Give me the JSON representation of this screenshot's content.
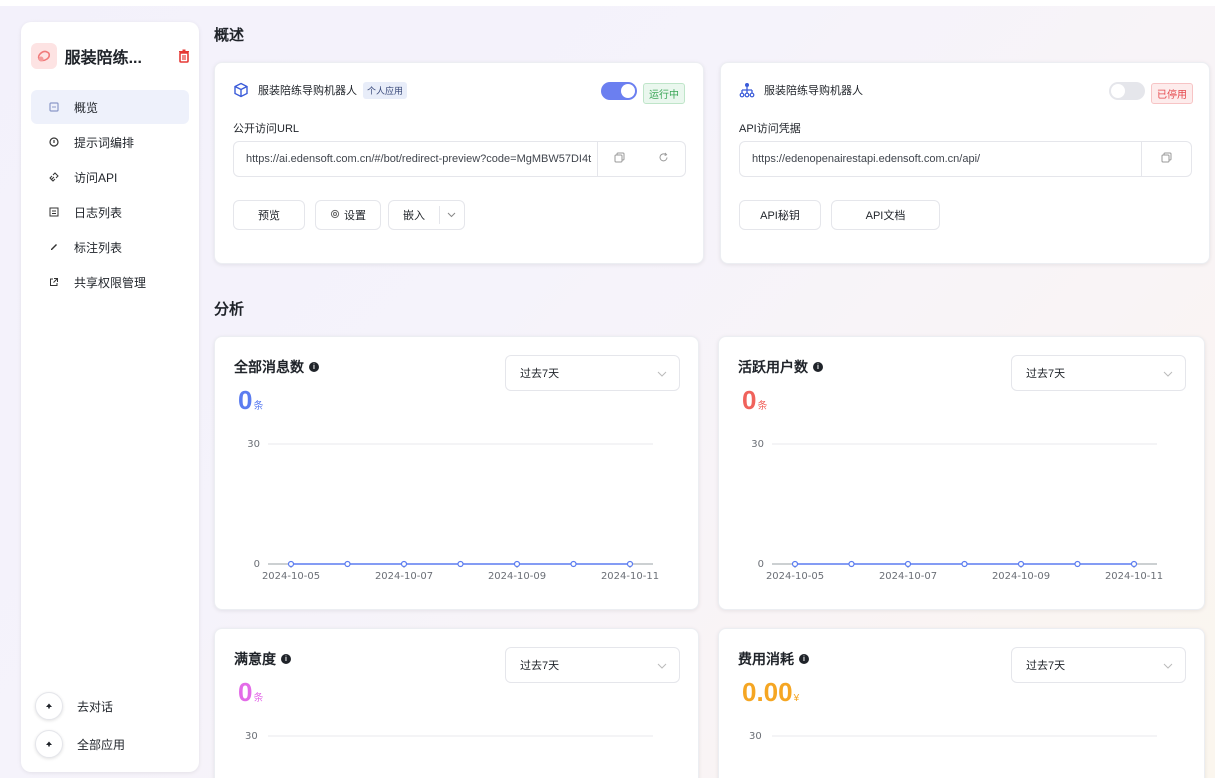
{
  "sidebar": {
    "app_name": "服装陪练...",
    "nav": [
      {
        "label": "概览",
        "icon": "dashboard-icon",
        "active": true
      },
      {
        "label": "提示词编排",
        "icon": "prompt-icon",
        "active": false
      },
      {
        "label": "访问API",
        "icon": "api-link-icon",
        "active": false
      },
      {
        "label": "日志列表",
        "icon": "log-icon",
        "active": false
      },
      {
        "label": "标注列表",
        "icon": "pencil-icon",
        "active": false
      },
      {
        "label": "共享权限管理",
        "icon": "share-icon",
        "active": false
      }
    ],
    "bottom": [
      {
        "label": "去对话",
        "icon": "back-arrow-icon"
      },
      {
        "label": "全部应用",
        "icon": "back-arrow-icon"
      }
    ]
  },
  "overview": {
    "title": "概述",
    "public_card": {
      "bot_name": "服装陪练导购机器人",
      "badge": "个人应用",
      "status": "运行中",
      "enabled": true,
      "field_label": "公开访问URL",
      "url": "https://ai.edensoft.com.cn/#/bot/redirect-preview?code=MgMBW57DI4t",
      "buttons": {
        "preview": "预览",
        "settings": "设置",
        "embed": "嵌入"
      }
    },
    "api_card": {
      "bot_name": "服装陪练导购机器人",
      "status": "已停用",
      "enabled": false,
      "field_label": "API访问凭据",
      "url": "https://edenopenairestapi.edensoft.com.cn/api/",
      "buttons": {
        "secret": "API秘钥",
        "docs": "API文档"
      }
    }
  },
  "analysis": {
    "title": "分析",
    "cards": [
      {
        "title": "全部消息数",
        "value": "0",
        "unit": "条",
        "color": "#5b7cf0",
        "range": "过去7天"
      },
      {
        "title": "活跃用户数",
        "value": "0",
        "unit": "条",
        "color": "#f0625b",
        "range": "过去7天"
      },
      {
        "title": "满意度",
        "value": "0",
        "unit": "条",
        "color": "#e36be8",
        "range": "过去7天"
      },
      {
        "title": "费用消耗",
        "value": "0.00",
        "unit": "¥",
        "color": "#f5a623",
        "range": "过去7天"
      }
    ]
  },
  "chart_data": [
    {
      "type": "line",
      "x": [
        "2024-10-05",
        "2024-10-06",
        "2024-10-07",
        "2024-10-08",
        "2024-10-09",
        "2024-10-10",
        "2024-10-11"
      ],
      "x_tick_labels": [
        "2024-10-05",
        "2024-10-07",
        "2024-10-09",
        "2024-10-11"
      ],
      "series": [
        {
          "values": [
            0,
            0,
            0,
            0,
            0,
            0,
            0
          ],
          "color": "#5b7cf0"
        }
      ],
      "ylim": [
        0,
        30
      ],
      "y_ticks": [
        "0",
        "30"
      ],
      "grid": true
    },
    {
      "type": "line",
      "x": [
        "2024-10-05",
        "2024-10-06",
        "2024-10-07",
        "2024-10-08",
        "2024-10-09",
        "2024-10-10",
        "2024-10-11"
      ],
      "x_tick_labels": [
        "2024-10-05",
        "2024-10-07",
        "2024-10-09",
        "2024-10-11"
      ],
      "series": [
        {
          "values": [
            0,
            0,
            0,
            0,
            0,
            0,
            0
          ],
          "color": "#5b7cf0"
        }
      ],
      "ylim": [
        0,
        30
      ],
      "y_ticks": [
        "0",
        "30"
      ],
      "grid": true
    }
  ],
  "partial_axes": {
    "y_top_label": "30"
  }
}
